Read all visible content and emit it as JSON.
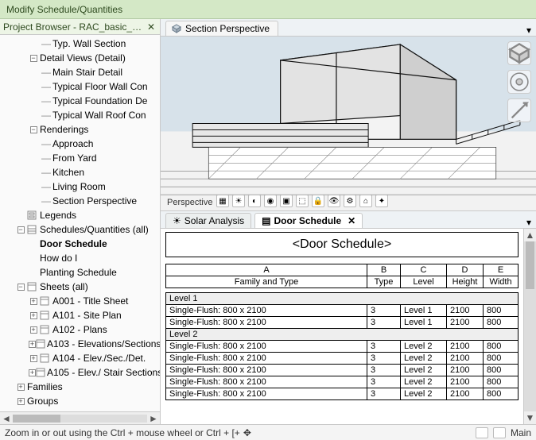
{
  "title": "Modify Schedule/Quantities",
  "browser": {
    "header": "Project Browser - RAC_basic_sa...",
    "items": [
      {
        "indent": 3,
        "label": "Typ. Wall Section",
        "icon": "dash"
      },
      {
        "indent": 2,
        "label": "Detail Views (Detail)",
        "icon": "minus"
      },
      {
        "indent": 3,
        "label": "Main Stair Detail",
        "icon": "dash"
      },
      {
        "indent": 3,
        "label": "Typical Floor Wall Con",
        "icon": "dash"
      },
      {
        "indent": 3,
        "label": "Typical Foundation De",
        "icon": "dash"
      },
      {
        "indent": 3,
        "label": "Typical Wall Roof Con",
        "icon": "dash"
      },
      {
        "indent": 2,
        "label": "Renderings",
        "icon": "minus"
      },
      {
        "indent": 3,
        "label": "Approach",
        "icon": "dash"
      },
      {
        "indent": 3,
        "label": "From Yard",
        "icon": "dash"
      },
      {
        "indent": 3,
        "label": "Kitchen",
        "icon": "dash"
      },
      {
        "indent": 3,
        "label": "Living Room",
        "icon": "dash"
      },
      {
        "indent": 3,
        "label": "Section Perspective",
        "icon": "dash"
      },
      {
        "indent": 1,
        "label": "Legends",
        "icon": "legend"
      },
      {
        "indent": 1,
        "label": "Schedules/Quantities (all)",
        "icon": "minus-sched"
      },
      {
        "indent": 2,
        "label": "Door Schedule",
        "icon": "none",
        "bold": true
      },
      {
        "indent": 2,
        "label": "How do I",
        "icon": "none"
      },
      {
        "indent": 2,
        "label": "Planting Schedule",
        "icon": "none"
      },
      {
        "indent": 1,
        "label": "Sheets (all)",
        "icon": "minus-sheet"
      },
      {
        "indent": 2,
        "label": "A001 - Title Sheet",
        "icon": "plus-sheet"
      },
      {
        "indent": 2,
        "label": "A101 - Site Plan",
        "icon": "plus-sheet"
      },
      {
        "indent": 2,
        "label": "A102 - Plans",
        "icon": "plus-sheet"
      },
      {
        "indent": 2,
        "label": "A103 - Elevations/Sections",
        "icon": "plus-sheet"
      },
      {
        "indent": 2,
        "label": "A104 - Elev./Sec./Det.",
        "icon": "plus-sheet"
      },
      {
        "indent": 2,
        "label": "A105 - Elev./ Stair Sections",
        "icon": "plus-sheet"
      },
      {
        "indent": 1,
        "label": "Families",
        "icon": "plus"
      },
      {
        "indent": 1,
        "label": "Groups",
        "icon": "plus"
      }
    ]
  },
  "viewTab": {
    "label": "Section Perspective",
    "footerLabel": "Perspective"
  },
  "schedTabs": {
    "inactive": "Solar Analysis",
    "active": "Door Schedule"
  },
  "schedule": {
    "title": "<Door Schedule>",
    "letters": [
      "A",
      "B",
      "C",
      "D",
      "E"
    ],
    "headers": [
      "Family and Type",
      "Type",
      "Level",
      "Height",
      "Width"
    ],
    "groups": [
      {
        "name": "Level 1",
        "rows": [
          [
            "Single-Flush: 800 x 2100",
            "3",
            "Level 1",
            "2100",
            "800"
          ],
          [
            "Single-Flush: 800 x 2100",
            "3",
            "Level 1",
            "2100",
            "800"
          ]
        ]
      },
      {
        "name": "Level 2",
        "rows": [
          [
            "Single-Flush: 800 x 2100",
            "3",
            "Level 2",
            "2100",
            "800"
          ],
          [
            "Single-Flush: 800 x 2100",
            "3",
            "Level 2",
            "2100",
            "800"
          ],
          [
            "Single-Flush: 800 x 2100",
            "3",
            "Level 2",
            "2100",
            "800"
          ],
          [
            "Single-Flush: 800 x 2100",
            "3",
            "Level 2",
            "2100",
            "800"
          ],
          [
            "Single-Flush: 800 x 2100",
            "3",
            "Level 2",
            "2100",
            "800"
          ]
        ]
      }
    ]
  },
  "status": {
    "text": "Zoom in or out using the Ctrl + mouse wheel or Ctrl + [+",
    "modelLabel": "Main"
  }
}
